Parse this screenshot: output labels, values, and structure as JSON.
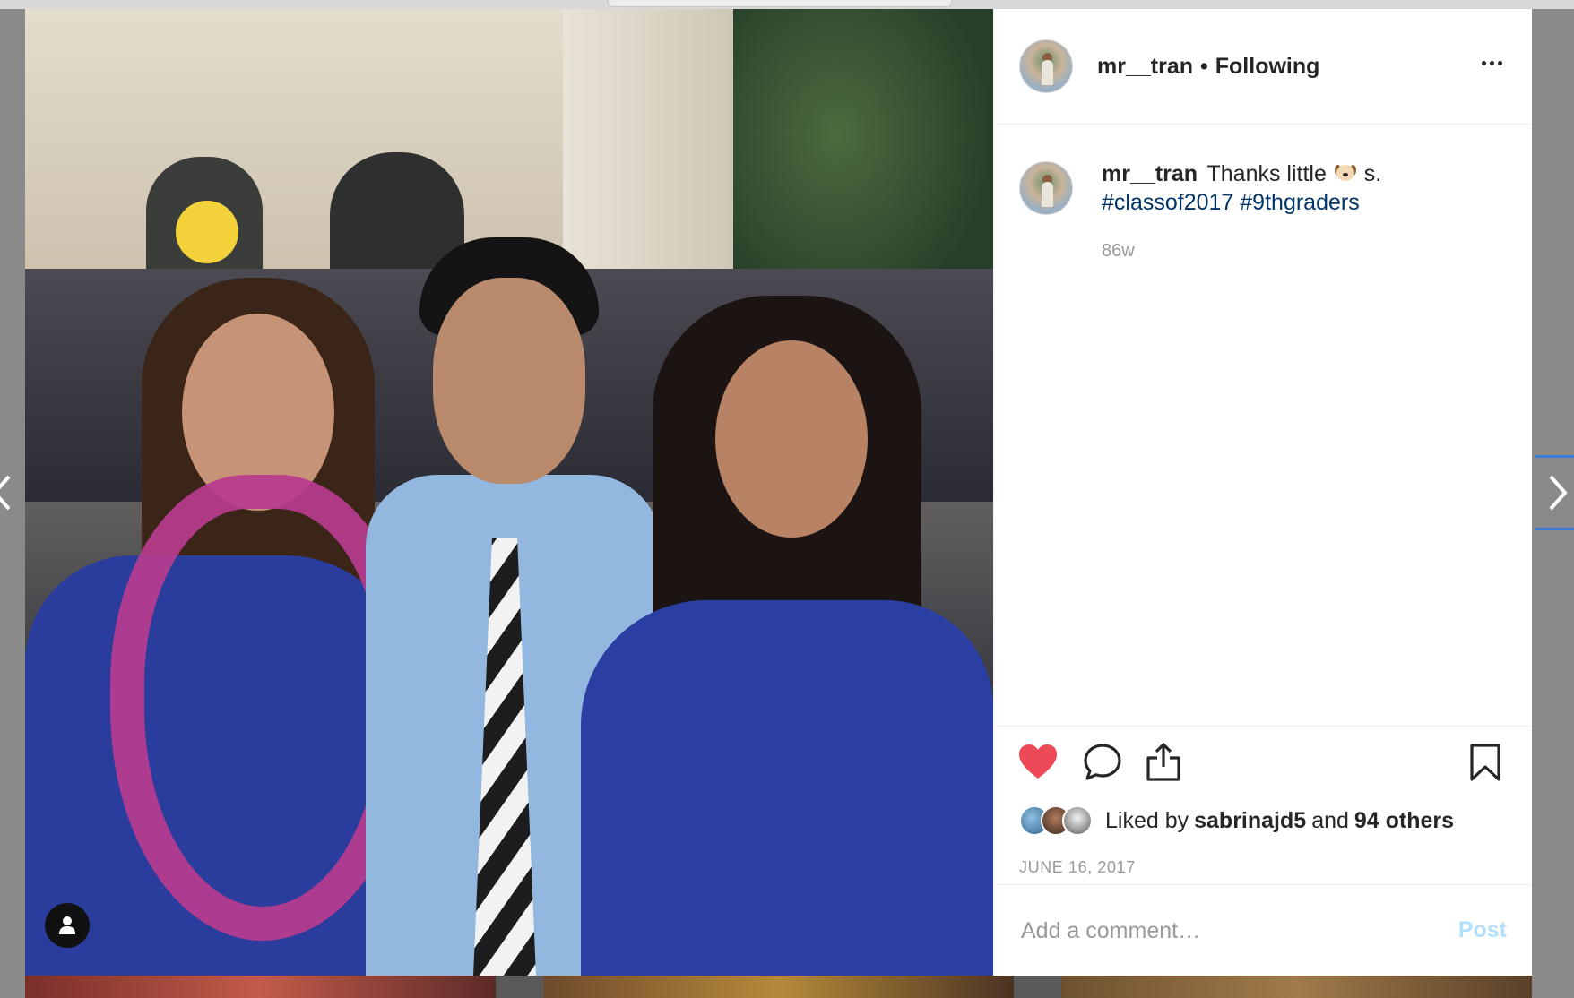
{
  "post": {
    "username": "mr__tran",
    "dot": "•",
    "following_label": "Following",
    "caption": {
      "username": "mr__tran",
      "text_before_emoji": "Thanks little",
      "text_after_emoji": "s.",
      "hashtags": [
        "#classof2017",
        "#9thgraders"
      ],
      "age": "86w"
    },
    "likes": {
      "prefix": "Liked by",
      "liker": "sabrinajd5",
      "conjunction": "and",
      "others": "94 others"
    },
    "date": "JUNE 16, 2017",
    "comment": {
      "placeholder": "Add a comment…",
      "post_label": "Post"
    }
  },
  "colors": {
    "heart": "#ed4956",
    "hashtag": "#003569",
    "muted": "#999999",
    "post_disabled": "#b2dffc"
  },
  "icons": {
    "more": "more-horizontal-icon",
    "like": "heart-filled-icon",
    "comment": "comment-bubble-icon",
    "share": "share-upload-icon",
    "save": "bookmark-icon",
    "tag": "user-tag-icon",
    "emoji": "dog-face-emoji",
    "next": "chevron-right-icon",
    "prev": "chevron-left-icon"
  }
}
